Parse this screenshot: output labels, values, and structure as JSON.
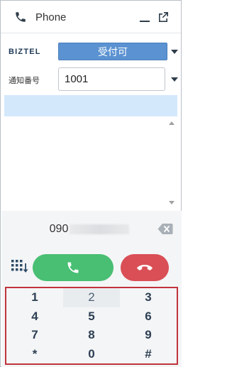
{
  "title": "Phone",
  "status": {
    "logo": "BIZTEL",
    "button_label": "受付可"
  },
  "caller_id": {
    "label": "通知番号",
    "value": "1001"
  },
  "dialer": {
    "number_prefix": "090",
    "keys": [
      "1",
      "2",
      "3",
      "4",
      "5",
      "6",
      "7",
      "8",
      "9",
      "*",
      "0",
      "#"
    ]
  },
  "colors": {
    "status_button": "#5b92d1",
    "info_bar": "#d4e8fb",
    "call_button": "#48bf73",
    "hangup_button": "#d94f55",
    "keypad_border": "#c0343c"
  },
  "icons": {
    "title": "phone-icon",
    "minimize": "minimize-icon",
    "popout": "popout-icon",
    "backspace": "backspace-icon",
    "dialpad": "dialpad-icon",
    "call": "phone-icon",
    "hangup": "hangup-icon"
  }
}
